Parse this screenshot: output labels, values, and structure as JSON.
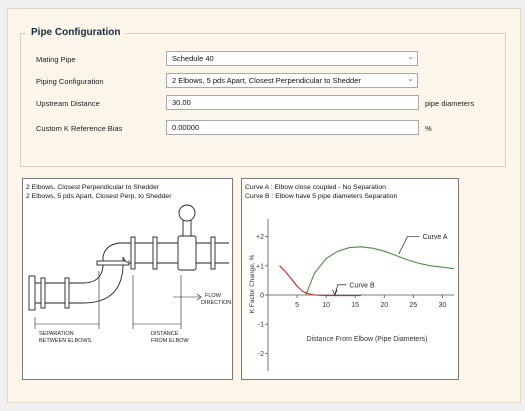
{
  "group_title": "Pipe Configuration",
  "rows": [
    {
      "label": "Mating Pipe",
      "value": "Schedule 40"
    },
    {
      "label": "Piping Configuration",
      "value": "2 Elbows, 5 pds Apart, Closest Perpendicular to Shedder"
    },
    {
      "label": "Upstream Distance",
      "value": "30.00",
      "unit": "pipe diameters"
    },
    {
      "label": "Custom K Reference Bias",
      "value": "0.00000",
      "unit": "%"
    }
  ],
  "illustration": {
    "line1": "2 Elbows, Closest Perpendicular to Shedder",
    "line2": "2 Elbows, 5 pds Apart, Closest Perp. to Shedder",
    "flow_label_1": "FLOW",
    "flow_label_2": "DIRECTION",
    "left_label_1": "SEPARATION",
    "left_label_2": "BETWEEN ELBOWS",
    "right_label_1": "DISTANCE",
    "right_label_2": "FROM ELBOW"
  },
  "curve_panel": {
    "line1": "Curve A : Elbow close coupled - No Separation",
    "line2": "Curve B : Elbow have 5 pipe diameters Separation"
  },
  "chart_data": {
    "type": "line",
    "xlabel": "Distance From Elbow (Pipe Diameters)",
    "ylabel": "K Factor Change, %",
    "xlim": [
      0,
      32
    ],
    "ylim": [
      -2.6,
      2.6
    ],
    "x_ticks": [
      5,
      10,
      15,
      20,
      25,
      30
    ],
    "y_ticks": [
      {
        "value": 2,
        "label": "+2"
      },
      {
        "value": 1,
        "label": "+1"
      },
      {
        "value": 0,
        "label": "0"
      },
      {
        "value": -1,
        "label": "-1"
      },
      {
        "value": -2,
        "label": "-2"
      }
    ],
    "grid": false,
    "series": [
      {
        "name": "Curve A",
        "color": "#4f8c47",
        "x": [
          6.5,
          8,
          10,
          12,
          14,
          16,
          18,
          20,
          22,
          24,
          26,
          28,
          30,
          32
        ],
        "y": [
          0.0,
          0.75,
          1.25,
          1.5,
          1.62,
          1.65,
          1.6,
          1.5,
          1.35,
          1.2,
          1.08,
          1.0,
          0.95,
          0.9
        ]
      },
      {
        "name": "Curve B",
        "color": "#cc2b2b",
        "x": [
          2,
          3,
          4,
          5,
          6,
          7,
          8,
          10,
          12,
          14,
          16
        ],
        "y": [
          1.0,
          0.8,
          0.55,
          0.3,
          0.12,
          0.04,
          0.0,
          -0.02,
          -0.02,
          -0.02,
          -0.02
        ]
      }
    ]
  }
}
